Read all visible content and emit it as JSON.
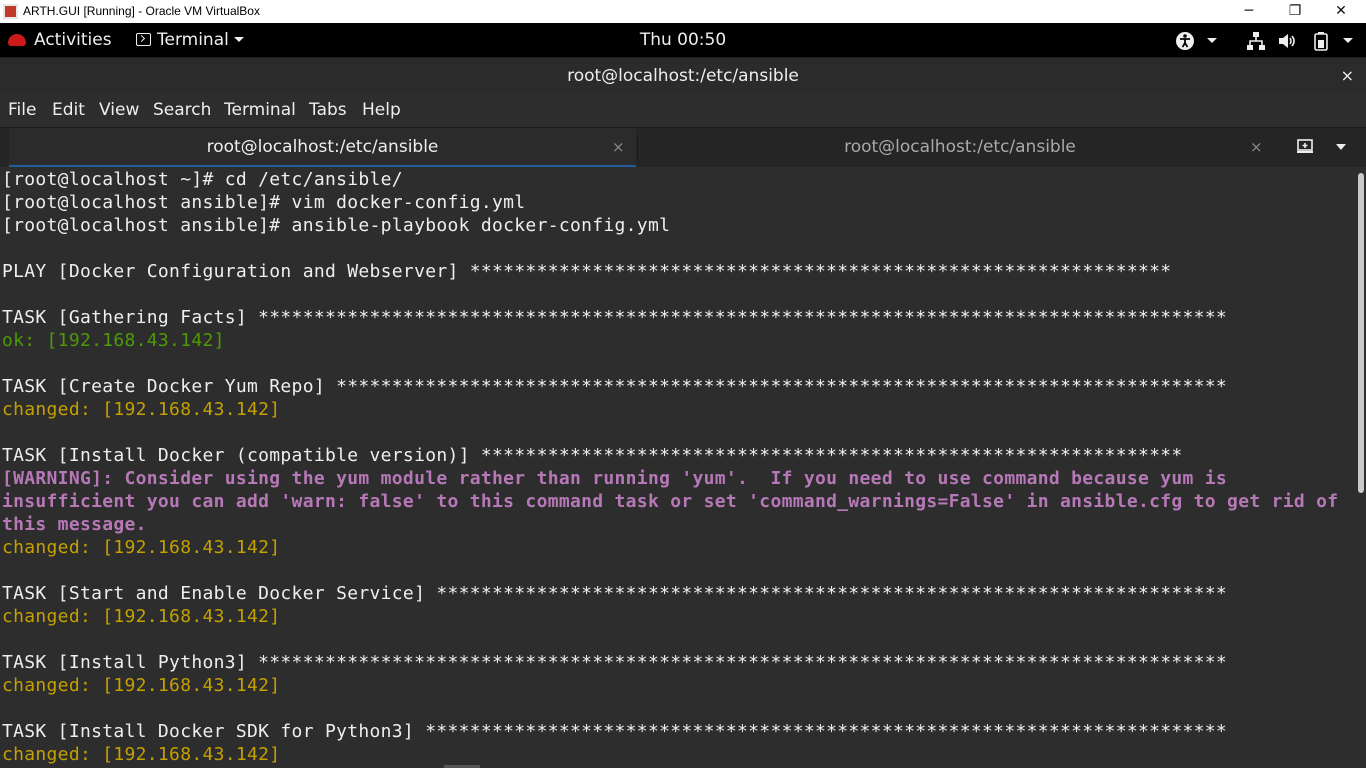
{
  "vbox": {
    "title": "ARTH.GUI [Running] - Oracle VM VirtualBox",
    "minimize": "─",
    "restore": "❐",
    "close": "✕"
  },
  "topbar": {
    "activities": "Activities",
    "app_menu": "Terminal",
    "clock": "Thu 00:50",
    "icons": [
      "accessibility-icon",
      "network-icon",
      "volume-icon",
      "battery-icon",
      "power-menu-icon"
    ]
  },
  "window": {
    "title": "root@localhost:/etc/ansible",
    "close": "×"
  },
  "menubar": {
    "items": [
      "File",
      "Edit",
      "View",
      "Search",
      "Terminal",
      "Tabs",
      "Help"
    ]
  },
  "tabs": [
    {
      "label": "root@localhost:/etc/ansible",
      "close": "×"
    },
    {
      "label": "root@localhost:/etc/ansible",
      "close": "×"
    }
  ],
  "terminal": {
    "lines": [
      {
        "text": "[root@localhost ~]# cd /etc/ansible/",
        "style": "normal"
      },
      {
        "text": "[root@localhost ansible]# vim docker-config.yml",
        "style": "normal"
      },
      {
        "text": "[root@localhost ansible]# ansible-playbook docker-config.yml",
        "style": "normal"
      },
      {
        "text": "",
        "style": "normal"
      },
      {
        "text": "PLAY [Docker Configuration and Webserver] ***************************************************************",
        "style": "normal"
      },
      {
        "text": "",
        "style": "normal"
      },
      {
        "text": "TASK [Gathering Facts] ***************************************************************************************",
        "style": "normal"
      },
      {
        "text": "ok: [192.168.43.142]",
        "style": "ok"
      },
      {
        "text": "",
        "style": "normal"
      },
      {
        "text": "TASK [Create Docker Yum Repo] ********************************************************************************",
        "style": "normal"
      },
      {
        "text": "changed: [192.168.43.142]",
        "style": "changed"
      },
      {
        "text": "",
        "style": "normal"
      },
      {
        "text": "TASK [Install Docker (compatible version)] ***************************************************************",
        "style": "normal"
      },
      {
        "text": "[WARNING]: Consider using the yum module rather than running 'yum'.  If you need to use command because yum is",
        "style": "warn"
      },
      {
        "text": "insufficient you can add 'warn: false' to this command task or set 'command_warnings=False' in ansible.cfg to get rid of",
        "style": "warn"
      },
      {
        "text": "this message.",
        "style": "warn"
      },
      {
        "text": "changed: [192.168.43.142]",
        "style": "changed"
      },
      {
        "text": "",
        "style": "normal"
      },
      {
        "text": "TASK [Start and Enable Docker Service] ***********************************************************************",
        "style": "normal"
      },
      {
        "text": "changed: [192.168.43.142]",
        "style": "changed"
      },
      {
        "text": "",
        "style": "normal"
      },
      {
        "text": "TASK [Install Python3] ***************************************************************************************",
        "style": "normal"
      },
      {
        "text": "changed: [192.168.43.142]",
        "style": "changed"
      },
      {
        "text": "",
        "style": "normal"
      },
      {
        "text": "TASK [Install Docker SDK for Python3] ************************************************************************",
        "style": "normal"
      },
      {
        "text": "changed: [192.168.43.142]",
        "style": "changed"
      }
    ]
  },
  "colors": {
    "ok": "#4e9a06",
    "changed": "#c4a000",
    "warning": "#b778b7",
    "tab_underline": "#215d9c"
  }
}
